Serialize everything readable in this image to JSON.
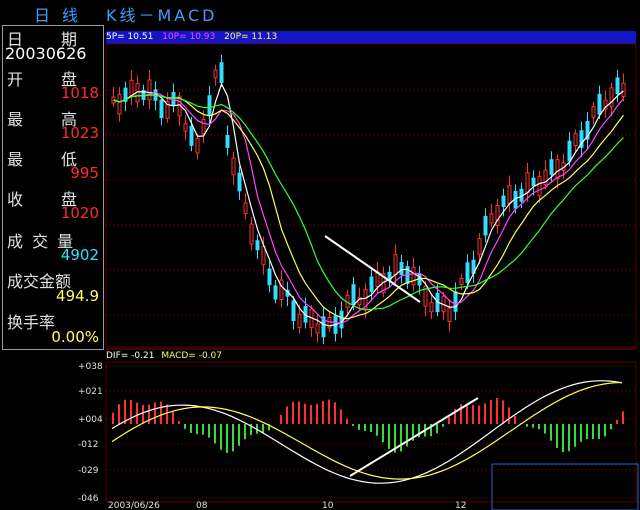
{
  "title": {
    "period_a": "日",
    "period_b": "线",
    "chart_name": "K线－MACD"
  },
  "info_panel": {
    "date_label": "日　　期",
    "date_value": "20030626",
    "open_label": "开　　盘",
    "open_value": "1018",
    "high_label": "最　　高",
    "high_value": "1023",
    "low_label": "最　　低",
    "low_value": "995",
    "close_label": "收　　盘",
    "close_value": "1020",
    "volume_label": "成 交 量",
    "volume_value": "4902",
    "amount_label": "成交金额",
    "amount_value": "494.9",
    "turnover_label": "换手率",
    "turnover_value": "0.00%"
  },
  "main_legend": {
    "ma1": "5P= 10.51",
    "ma2": "10P= 10.93",
    "ma3": "20P= 11.13"
  },
  "macd_legend": {
    "dif": "DIF= -0.21",
    "macd": "MACD= -0.07"
  },
  "y_axis_macd": [
    "+038",
    "+021",
    "+004",
    "-012",
    "-029",
    "-046"
  ],
  "x_axis": [
    "2003/06/26",
    "08",
    "10",
    "12"
  ],
  "colors": {
    "up_candle": "#ff3030",
    "down_candle": "#33ddff",
    "ma5": "#ffffff",
    "ma10": "#ff44ff",
    "ma20": "#ffff55",
    "ma30": "#33ff33",
    "grid": "#8a0000",
    "legend_bg": "#1414c8"
  }
}
